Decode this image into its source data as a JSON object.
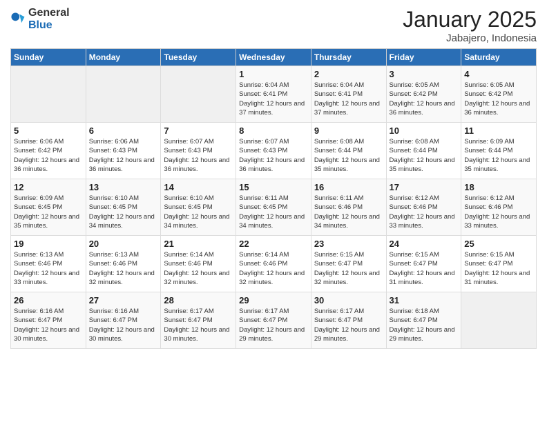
{
  "logo": {
    "text_general": "General",
    "text_blue": "Blue"
  },
  "header": {
    "month": "January 2025",
    "location": "Jabajero, Indonesia"
  },
  "weekdays": [
    "Sunday",
    "Monday",
    "Tuesday",
    "Wednesday",
    "Thursday",
    "Friday",
    "Saturday"
  ],
  "weeks": [
    [
      {
        "day": "",
        "sunrise": "",
        "sunset": "",
        "daylight": ""
      },
      {
        "day": "",
        "sunrise": "",
        "sunset": "",
        "daylight": ""
      },
      {
        "day": "",
        "sunrise": "",
        "sunset": "",
        "daylight": ""
      },
      {
        "day": "1",
        "sunrise": "Sunrise: 6:04 AM",
        "sunset": "Sunset: 6:41 PM",
        "daylight": "Daylight: 12 hours and 37 minutes."
      },
      {
        "day": "2",
        "sunrise": "Sunrise: 6:04 AM",
        "sunset": "Sunset: 6:41 PM",
        "daylight": "Daylight: 12 hours and 37 minutes."
      },
      {
        "day": "3",
        "sunrise": "Sunrise: 6:05 AM",
        "sunset": "Sunset: 6:42 PM",
        "daylight": "Daylight: 12 hours and 36 minutes."
      },
      {
        "day": "4",
        "sunrise": "Sunrise: 6:05 AM",
        "sunset": "Sunset: 6:42 PM",
        "daylight": "Daylight: 12 hours and 36 minutes."
      }
    ],
    [
      {
        "day": "5",
        "sunrise": "Sunrise: 6:06 AM",
        "sunset": "Sunset: 6:42 PM",
        "daylight": "Daylight: 12 hours and 36 minutes."
      },
      {
        "day": "6",
        "sunrise": "Sunrise: 6:06 AM",
        "sunset": "Sunset: 6:43 PM",
        "daylight": "Daylight: 12 hours and 36 minutes."
      },
      {
        "day": "7",
        "sunrise": "Sunrise: 6:07 AM",
        "sunset": "Sunset: 6:43 PM",
        "daylight": "Daylight: 12 hours and 36 minutes."
      },
      {
        "day": "8",
        "sunrise": "Sunrise: 6:07 AM",
        "sunset": "Sunset: 6:43 PM",
        "daylight": "Daylight: 12 hours and 36 minutes."
      },
      {
        "day": "9",
        "sunrise": "Sunrise: 6:08 AM",
        "sunset": "Sunset: 6:44 PM",
        "daylight": "Daylight: 12 hours and 35 minutes."
      },
      {
        "day": "10",
        "sunrise": "Sunrise: 6:08 AM",
        "sunset": "Sunset: 6:44 PM",
        "daylight": "Daylight: 12 hours and 35 minutes."
      },
      {
        "day": "11",
        "sunrise": "Sunrise: 6:09 AM",
        "sunset": "Sunset: 6:44 PM",
        "daylight": "Daylight: 12 hours and 35 minutes."
      }
    ],
    [
      {
        "day": "12",
        "sunrise": "Sunrise: 6:09 AM",
        "sunset": "Sunset: 6:45 PM",
        "daylight": "Daylight: 12 hours and 35 minutes."
      },
      {
        "day": "13",
        "sunrise": "Sunrise: 6:10 AM",
        "sunset": "Sunset: 6:45 PM",
        "daylight": "Daylight: 12 hours and 34 minutes."
      },
      {
        "day": "14",
        "sunrise": "Sunrise: 6:10 AM",
        "sunset": "Sunset: 6:45 PM",
        "daylight": "Daylight: 12 hours and 34 minutes."
      },
      {
        "day": "15",
        "sunrise": "Sunrise: 6:11 AM",
        "sunset": "Sunset: 6:45 PM",
        "daylight": "Daylight: 12 hours and 34 minutes."
      },
      {
        "day": "16",
        "sunrise": "Sunrise: 6:11 AM",
        "sunset": "Sunset: 6:46 PM",
        "daylight": "Daylight: 12 hours and 34 minutes."
      },
      {
        "day": "17",
        "sunrise": "Sunrise: 6:12 AM",
        "sunset": "Sunset: 6:46 PM",
        "daylight": "Daylight: 12 hours and 33 minutes."
      },
      {
        "day": "18",
        "sunrise": "Sunrise: 6:12 AM",
        "sunset": "Sunset: 6:46 PM",
        "daylight": "Daylight: 12 hours and 33 minutes."
      }
    ],
    [
      {
        "day": "19",
        "sunrise": "Sunrise: 6:13 AM",
        "sunset": "Sunset: 6:46 PM",
        "daylight": "Daylight: 12 hours and 33 minutes."
      },
      {
        "day": "20",
        "sunrise": "Sunrise: 6:13 AM",
        "sunset": "Sunset: 6:46 PM",
        "daylight": "Daylight: 12 hours and 32 minutes."
      },
      {
        "day": "21",
        "sunrise": "Sunrise: 6:14 AM",
        "sunset": "Sunset: 6:46 PM",
        "daylight": "Daylight: 12 hours and 32 minutes."
      },
      {
        "day": "22",
        "sunrise": "Sunrise: 6:14 AM",
        "sunset": "Sunset: 6:46 PM",
        "daylight": "Daylight: 12 hours and 32 minutes."
      },
      {
        "day": "23",
        "sunrise": "Sunrise: 6:15 AM",
        "sunset": "Sunset: 6:47 PM",
        "daylight": "Daylight: 12 hours and 32 minutes."
      },
      {
        "day": "24",
        "sunrise": "Sunrise: 6:15 AM",
        "sunset": "Sunset: 6:47 PM",
        "daylight": "Daylight: 12 hours and 31 minutes."
      },
      {
        "day": "25",
        "sunrise": "Sunrise: 6:15 AM",
        "sunset": "Sunset: 6:47 PM",
        "daylight": "Daylight: 12 hours and 31 minutes."
      }
    ],
    [
      {
        "day": "26",
        "sunrise": "Sunrise: 6:16 AM",
        "sunset": "Sunset: 6:47 PM",
        "daylight": "Daylight: 12 hours and 30 minutes."
      },
      {
        "day": "27",
        "sunrise": "Sunrise: 6:16 AM",
        "sunset": "Sunset: 6:47 PM",
        "daylight": "Daylight: 12 hours and 30 minutes."
      },
      {
        "day": "28",
        "sunrise": "Sunrise: 6:17 AM",
        "sunset": "Sunset: 6:47 PM",
        "daylight": "Daylight: 12 hours and 30 minutes."
      },
      {
        "day": "29",
        "sunrise": "Sunrise: 6:17 AM",
        "sunset": "Sunset: 6:47 PM",
        "daylight": "Daylight: 12 hours and 29 minutes."
      },
      {
        "day": "30",
        "sunrise": "Sunrise: 6:17 AM",
        "sunset": "Sunset: 6:47 PM",
        "daylight": "Daylight: 12 hours and 29 minutes."
      },
      {
        "day": "31",
        "sunrise": "Sunrise: 6:18 AM",
        "sunset": "Sunset: 6:47 PM",
        "daylight": "Daylight: 12 hours and 29 minutes."
      },
      {
        "day": "",
        "sunrise": "",
        "sunset": "",
        "daylight": ""
      }
    ]
  ]
}
